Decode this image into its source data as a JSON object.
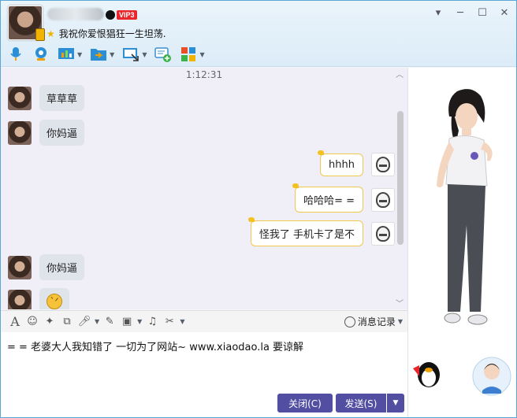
{
  "header": {
    "signature": "我祝你爱恨猖狂一生坦荡.",
    "vip_label": "VIP3"
  },
  "window_controls": {
    "settings": "▾",
    "minimize": "─",
    "maximize": "☐",
    "close": "✕"
  },
  "toolbar": {
    "items": [
      {
        "icon": "microphone-icon",
        "has_menu": false
      },
      {
        "icon": "video-camera-icon",
        "has_menu": false
      },
      {
        "icon": "remote-desktop-icon",
        "has_menu": true
      },
      {
        "icon": "file-transfer-icon",
        "has_menu": true
      },
      {
        "icon": "screen-share-icon",
        "has_menu": true
      },
      {
        "icon": "create-discussion-icon",
        "has_menu": false
      },
      {
        "icon": "apps-grid-icon",
        "has_menu": true
      }
    ]
  },
  "chat": {
    "timestamp": "1:12:31",
    "messages": [
      {
        "side": "in",
        "text": "草草草"
      },
      {
        "side": "in",
        "text": "你妈逼"
      },
      {
        "side": "out",
        "text": "hhhh"
      },
      {
        "side": "out",
        "text": "哈哈哈= ="
      },
      {
        "side": "out",
        "text": "怪我了 手机卡了是不"
      },
      {
        "side": "in",
        "text": "你妈逼"
      },
      {
        "side": "in",
        "emoji": "angry-face-emoji"
      }
    ]
  },
  "input_toolbar": {
    "icons": [
      "font-icon",
      "emoji-icon",
      "shake-icon",
      "screenshot-icon",
      "voice-message-icon",
      "doodle-icon",
      "image-icon",
      "music-icon",
      "scissors-icon"
    ],
    "history_label": "消息记录"
  },
  "input": {
    "text": "= = 老婆大人我知错了 一切为了网站~ www.xiaodao.la 要谅解"
  },
  "footer": {
    "close_label": "关闭(C)",
    "send_label": "发送(S)"
  },
  "colors": {
    "accent_button": "#524fa3",
    "incoming_bubble": "#dfe3ea",
    "outgoing_border": "#f0c850",
    "vip_red": "#e8262b"
  }
}
